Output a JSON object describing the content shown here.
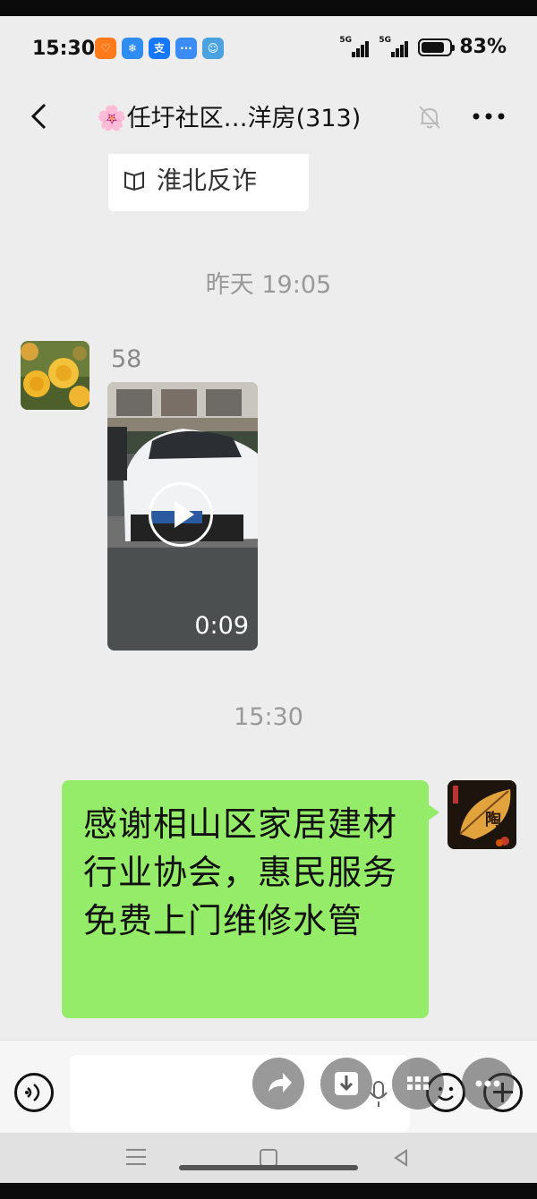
{
  "status_bar": {
    "time": "15:30",
    "app_icons": [
      {
        "name": "taobao-icon",
        "glyph": "♡",
        "color": "#ff7a1a"
      },
      {
        "name": "weather-icon",
        "glyph": "❄",
        "color": "#2f8cf0"
      },
      {
        "name": "alipay-icon",
        "glyph": "支",
        "color": "#1677ff"
      },
      {
        "name": "message-icon",
        "glyph": "···",
        "color": "#3b8cf5"
      },
      {
        "name": "kid-app-icon",
        "glyph": "☺",
        "color": "#4aa3e0"
      }
    ],
    "signal_1_label": "5G",
    "signal_2_label": "5G",
    "battery_level": 0.83,
    "battery_percent": "83%"
  },
  "header": {
    "title_emoji": "🌸",
    "title": "任圩社区…洋房(313)"
  },
  "messages": {
    "shared_card_label": "淮北反诈",
    "timestamp_1": "昨天 19:05",
    "sender_name": "58",
    "video_duration": "0:09",
    "timestamp_2": "15:30",
    "my_message": "感谢相山区家居建材行业协会，惠民服务免费上门维修水管",
    "my_avatar_text": "陶"
  },
  "colors": {
    "bubble_green": "#95ec69",
    "chat_bg": "#ededed"
  }
}
